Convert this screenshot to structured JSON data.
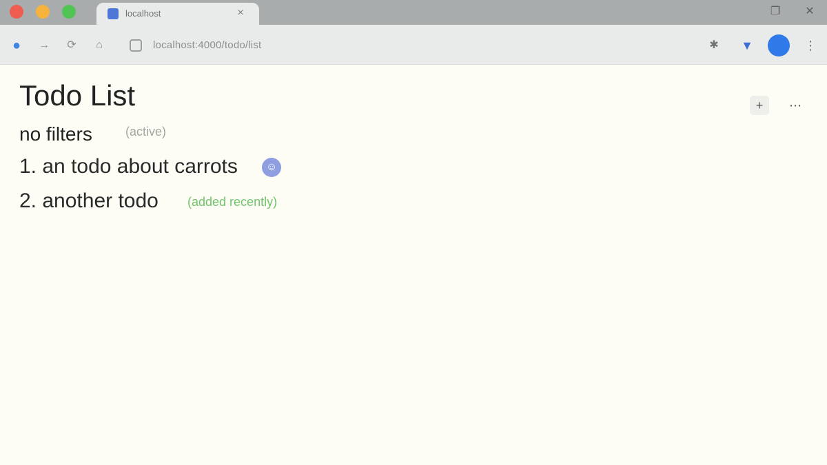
{
  "browser": {
    "tab": {
      "title": "localhost"
    },
    "address": {
      "url": "localhost:4000/todo/list"
    },
    "icons": [
      "back-icon",
      "forward-icon",
      "reload-icon",
      "home-icon",
      "lock-icon",
      "extension-icon",
      "shield-icon",
      "menu-icon"
    ],
    "colors": {
      "close": "#ee5d50",
      "minimize": "#f5b33d",
      "maximize": "#52c455",
      "profile": "#2f79e8"
    }
  },
  "page": {
    "title": "Todo List",
    "subtitle": "no filters",
    "subtitle_hint": "(active)",
    "items": [
      {
        "number": "1.",
        "text": "an todo about carrots"
      },
      {
        "number": "2.",
        "text": "another todo",
        "tag": "(added recently)"
      }
    ],
    "actions": {
      "add_label": "+",
      "more_label": "⋯"
    },
    "colors": {
      "badge": "#8f9ee0",
      "tag": "#6fc46a"
    }
  }
}
